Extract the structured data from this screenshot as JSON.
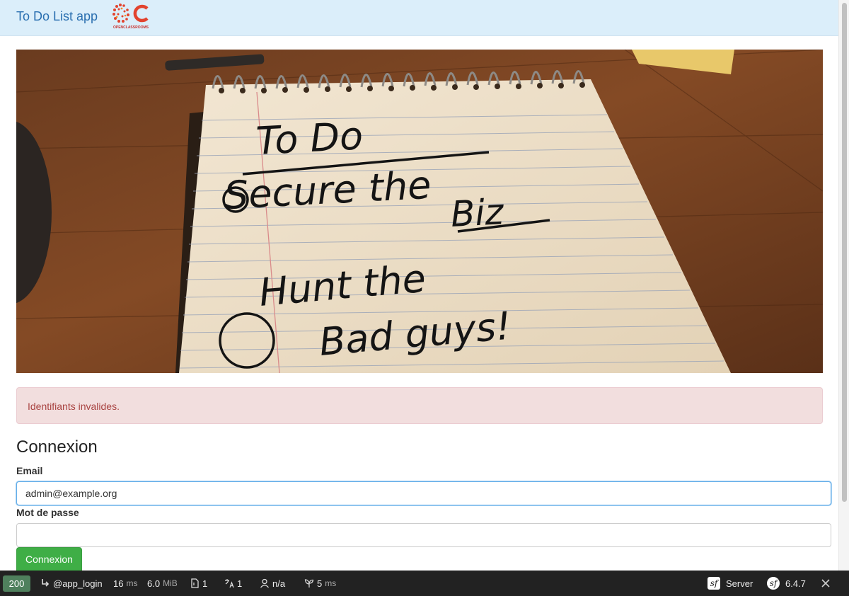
{
  "navbar": {
    "brand": "To Do List app",
    "logo_text": "OPENCLASSROOMS"
  },
  "alert": {
    "message": "Identifiants invalides."
  },
  "form": {
    "title": "Connexion",
    "email_label": "Email",
    "email_value": "admin@example.org",
    "password_label": "Mot de passe",
    "password_value": "",
    "submit_label": "Connexion"
  },
  "notepad": {
    "line1": "To Do",
    "line2": "Secure the",
    "line3": "Biz",
    "line4": "Hunt the",
    "line5": "Bad guys!"
  },
  "debug_toolbar": {
    "status_code": "200",
    "route": "@app_login",
    "time_value": "16",
    "time_unit": "ms",
    "memory_value": "6.0",
    "memory_unit": "MiB",
    "forms_count": "1",
    "translations_count": "1",
    "user": "n/a",
    "twig_value": "5",
    "twig_unit": "ms",
    "server_label": "Server",
    "version": "6.4.7"
  },
  "colors": {
    "navbar_bg": "#dbeefa",
    "brand": "#2a6fb0",
    "alert_bg": "#f2dede",
    "alert_text": "#a94442",
    "submit_bg": "#3fae46",
    "status_ok": "#4f805d"
  }
}
